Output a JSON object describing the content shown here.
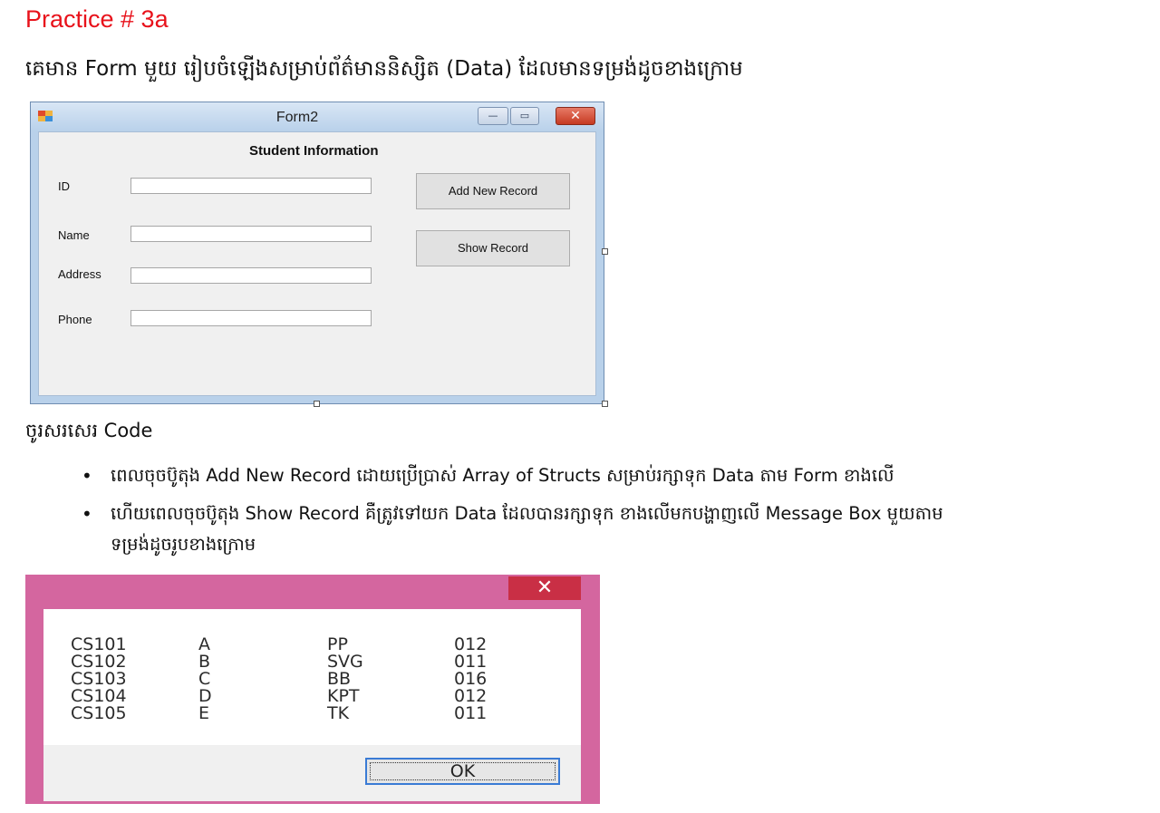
{
  "title": "Practice # 3a",
  "intro": "គេមាន Form មួយ រៀបចំឡើងសម្រាប់ព័ត៌មាននិស្សិត (Data) ដែលមានទម្រង់ដូចខាងក្រោម",
  "form": {
    "window_title": "Form2",
    "heading": "Student Information",
    "fields": [
      {
        "label": "ID"
      },
      {
        "label": "Name"
      },
      {
        "label": "Address"
      },
      {
        "label": "Phone"
      }
    ],
    "buttons": {
      "add": "Add New Record",
      "show": "Show Record"
    },
    "window_buttons": {
      "minimize": "—",
      "maximize": "▭",
      "close": "✕"
    }
  },
  "code_heading": "ចូរសរសេរ Code",
  "tasks": [
    "ពេលចុចប៊ូតុង Add New Record ដោយប្រើប្រាស់ Array of Structs សម្រាប់រក្សាទុក Data តាម Form ខាងលើ",
    "ហើយពេលចុចប៊ូតុង Show Record គឺត្រូវទៅយក Data ដែលបានរក្សាទុក ខាងលើមកបង្ហាញលើ Message Box មួយតាម",
    "ទម្រង់ដូចរូបខាងក្រោម"
  ],
  "bullet": "•",
  "message_box": {
    "close": "✕",
    "rows": [
      [
        "CS101",
        "A",
        "PP",
        "012"
      ],
      [
        "CS102",
        "B",
        "SVG",
        "011"
      ],
      [
        "CS103",
        "C",
        "BB",
        "016"
      ],
      [
        "CS104",
        "D",
        "KPT",
        "012"
      ],
      [
        "CS105",
        "E",
        "TK",
        "011"
      ]
    ],
    "ok": "OK"
  },
  "colors": {
    "title": "#e8121b",
    "form_frame": "#b9d1ea",
    "message_frame": "#d4669f",
    "message_close": "#c92f45"
  }
}
